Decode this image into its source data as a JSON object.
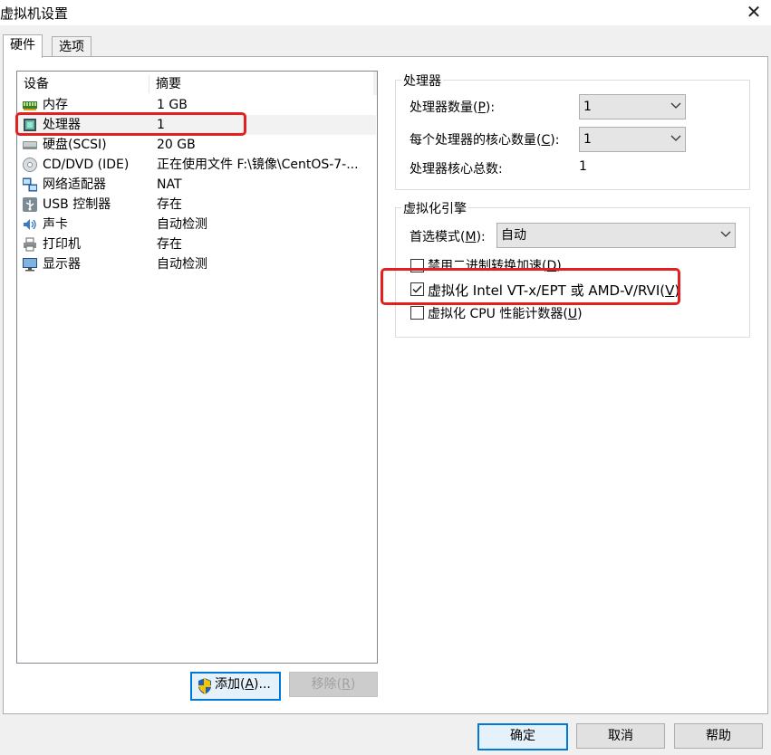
{
  "window": {
    "title": "虚拟机设置",
    "close_glyph": "✕"
  },
  "tabs": [
    {
      "label": "硬件"
    },
    {
      "label": "选项"
    }
  ],
  "device_list": {
    "columns": {
      "device": "设备",
      "summary": "摘要"
    },
    "items": [
      {
        "name": "内存",
        "summary": "1 GB",
        "icon": "memory-icon"
      },
      {
        "name": "处理器",
        "summary": "1",
        "icon": "processor-icon"
      },
      {
        "name": "硬盘(SCSI)",
        "summary": "20 GB",
        "icon": "harddisk-icon"
      },
      {
        "name": "CD/DVD (IDE)",
        "summary": "正在使用文件 F:\\镜像\\CentOS-7-...",
        "icon": "cd-dvd-icon"
      },
      {
        "name": "网络适配器",
        "summary": "NAT",
        "icon": "network-adapter-icon"
      },
      {
        "name": "USB 控制器",
        "summary": "存在",
        "icon": "usb-icon"
      },
      {
        "name": "声卡",
        "summary": "自动检测",
        "icon": "sound-card-icon"
      },
      {
        "name": "打印机",
        "summary": "存在",
        "icon": "printer-icon"
      },
      {
        "name": "显示器",
        "summary": "自动检测",
        "icon": "display-icon"
      }
    ],
    "selected_index": 1
  },
  "buttons": {
    "add": {
      "pre": "添加(",
      "key": "A",
      "post": ")..."
    },
    "remove": {
      "pre": "移除(",
      "key": "R",
      "post": ")"
    },
    "ok": "确定",
    "cancel": "取消",
    "help": "帮助"
  },
  "processor_group": {
    "title": "处理器",
    "count": {
      "pre": "处理器数量(",
      "key": "P",
      "post": "):",
      "value": "1"
    },
    "cores": {
      "pre": "每个处理器的核心数量(",
      "key": "C",
      "post": "):",
      "value": "1"
    },
    "total": {
      "label": "处理器核心总数:",
      "value": "1"
    }
  },
  "virtualization_group": {
    "title": "虚拟化引擎",
    "mode": {
      "pre": "首选模式(",
      "key": "M",
      "post": "):",
      "value": "自动"
    },
    "options": [
      {
        "pre": "禁用二进制转换加速(",
        "key": "D",
        "post": ")",
        "checked": false
      },
      {
        "pre": "虚拟化 Intel VT-x/EPT 或 AMD-V/RVI(",
        "key": "V",
        "post": ")",
        "checked": true
      },
      {
        "pre": "虚拟化 CPU 性能计数器(",
        "key": "U",
        "post": ")",
        "checked": false
      }
    ]
  },
  "colors": {
    "highlight": "#e32020",
    "accent": "#0078d7"
  }
}
